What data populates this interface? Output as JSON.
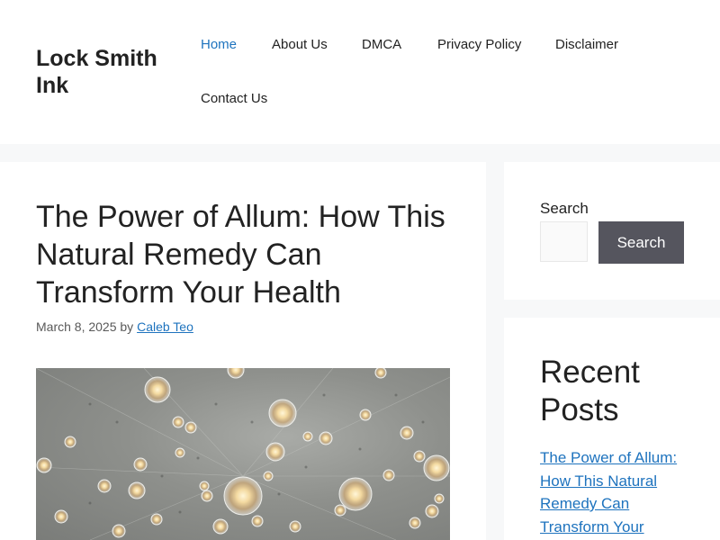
{
  "site": {
    "title": "Lock Smith Ink"
  },
  "nav": {
    "items": [
      {
        "label": "Home",
        "active": true
      },
      {
        "label": "About Us"
      },
      {
        "label": "DMCA"
      },
      {
        "label": "Privacy Policy"
      },
      {
        "label": "Disclaimer"
      },
      {
        "label": "Contact Us"
      }
    ]
  },
  "post": {
    "title": "The Power of Allum: How This Natural Remedy Can Transform Your Health",
    "date": "March 8, 2025",
    "by": "by",
    "author": "Caleb Teo",
    "image": "glowing-light-bulbs-photo"
  },
  "sidebar": {
    "search": {
      "label": "Search",
      "button": "Search",
      "placeholder": ""
    },
    "recent": {
      "title": "Recent Posts",
      "items": [
        {
          "label": "The Power of Allum: How This Natural Remedy Can Transform Your Health"
        }
      ]
    }
  },
  "colors": {
    "accent": "#1e73be",
    "button": "#55555e",
    "background": "#f7f8f9"
  }
}
